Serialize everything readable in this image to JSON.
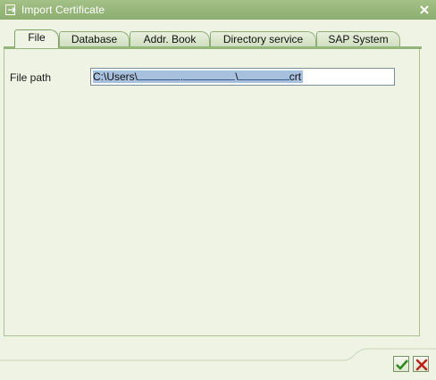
{
  "window": {
    "title": "Import Certificate",
    "accent": "#9ab97e"
  },
  "tabs": [
    {
      "label": "File",
      "active": true
    },
    {
      "label": "Database",
      "active": false
    },
    {
      "label": "Addr. Book",
      "active": false
    },
    {
      "label": "Directory service",
      "active": false
    },
    {
      "label": "SAP System",
      "active": false
    }
  ],
  "file_tab": {
    "path_label": "File path",
    "path_value": {
      "prefix": "C:\\Users\\",
      "sep1": ".",
      "sep2": "\\",
      "suffix": "crt"
    }
  },
  "icons": {
    "window_icon": "import-icon",
    "close": "close-icon",
    "ok": "checkmark-icon",
    "cancel": "cancel-icon"
  }
}
